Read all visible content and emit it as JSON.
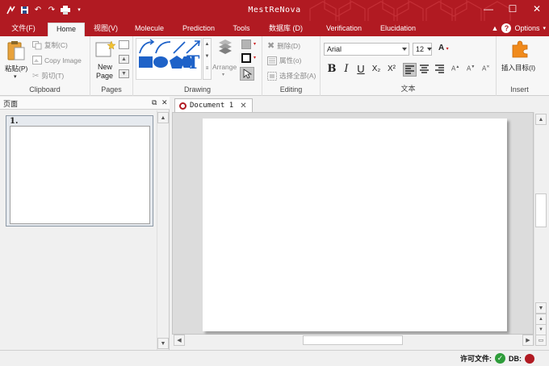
{
  "window": {
    "title": "MestReNova",
    "minimize": "—",
    "maximize": "☐",
    "close": "✕"
  },
  "qat": {
    "icons": [
      "mnova-logo-icon",
      "save-icon",
      "undo-icon",
      "redo-icon",
      "print-icon",
      "customize-icon"
    ]
  },
  "tabs": [
    {
      "label": "文件(F)"
    },
    {
      "label": "Home"
    },
    {
      "label": "视图(V)"
    },
    {
      "label": "Molecule"
    },
    {
      "label": "Prediction"
    },
    {
      "label": "Tools"
    },
    {
      "label": "数据库 (D)"
    },
    {
      "label": "Verification"
    },
    {
      "label": "Elucidation"
    }
  ],
  "ribbon_right": {
    "options": "Options"
  },
  "clipboard": {
    "label": "Clipboard",
    "paste": "粘贴(P)",
    "copy": "复制(C)",
    "copy_image": "Copy Image",
    "cut": "剪切(T)"
  },
  "pages": {
    "label": "Pages",
    "new_page_line1": "New",
    "new_page_line2": "Page"
  },
  "drawing": {
    "label": "Drawing",
    "arrange": "Arrange"
  },
  "editing": {
    "label": "Editing",
    "delete": "删除(D)",
    "properties": "属性(o)",
    "select_all": "选择全部(A)"
  },
  "text": {
    "label": "文本",
    "font": "Arial",
    "size": "12",
    "bold": "B",
    "italic": "I",
    "underline": "U",
    "subscript": "X₂",
    "superscript": "X²"
  },
  "insert": {
    "label": "Insert",
    "insert_target": "插入目标(I)"
  },
  "pages_panel": {
    "title": "页面",
    "page_number": "1."
  },
  "document": {
    "tab_label": "Document 1"
  },
  "status": {
    "license": "许可文件:",
    "db": "DB:"
  }
}
